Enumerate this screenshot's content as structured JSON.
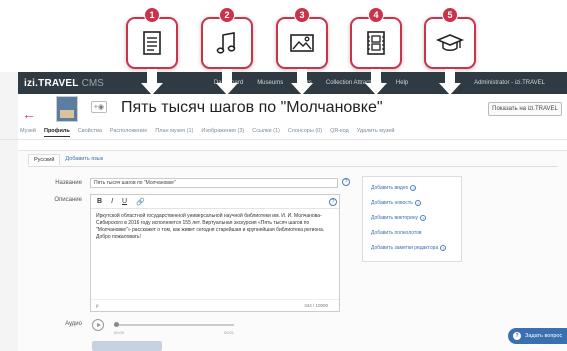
{
  "callouts": [
    {
      "num": "1",
      "icon": "document-icon"
    },
    {
      "num": "2",
      "icon": "music-note-icon"
    },
    {
      "num": "3",
      "icon": "image-icon"
    },
    {
      "num": "4",
      "icon": "film-icon"
    },
    {
      "num": "5",
      "icon": "graduation-cap-icon"
    }
  ],
  "topbar": {
    "brand": "izi.TRAVEL",
    "brand_sub": "CMS",
    "nav": [
      "Dashboard",
      "Museums",
      "Tours",
      "Collection Attractions",
      "Help"
    ],
    "admin": "Administrator - izi.TRAVEL"
  },
  "header": {
    "title": "Пять тысяч шагов по \"Молчановке\"",
    "show_button": "Показать на izi.TRAVEL"
  },
  "tabs": [
    "Музей",
    "Профиль",
    "Свойства",
    "Расположение",
    "План музея (1)",
    "Изображения (3)",
    "Ссылки (1)",
    "Спонсоры (0)",
    "QR-код",
    "Удалить музей"
  ],
  "lang_tabs": {
    "current": "Русский",
    "add": "Добавить язык"
  },
  "form": {
    "name_label": "Название",
    "name_value": "Пять тысяч шагов по \"Молчановке\"",
    "desc_label": "Описание",
    "desc_text": "Иркутской областной государственной универсальной научной библиотеки им. И. И. Молчанова-Сибирского в 2016 году исполняется 155 лет. Виртуальная экскурсия «Пять тысяч шагов по \"Молчановке\"» расскажет о том, как живет сегодня старейшая и крупнейшая библиотека региона. Добро пожаловать!",
    "editor_path": "p",
    "char_count": "344 / 10000",
    "audio_label": "Аудио",
    "audio_start": "00:00",
    "audio_end": "00:01"
  },
  "side_links": [
    "Добавить видео",
    "Добавить новость",
    "Добавить викторину",
    "Добавить полнолотов",
    "Добавить заметки редактора"
  ],
  "ask_button": "Задать вопрос",
  "colors": {
    "accent_red": "#c9344a",
    "topbar": "#2f3a42",
    "link_blue": "#3a6fb0"
  }
}
